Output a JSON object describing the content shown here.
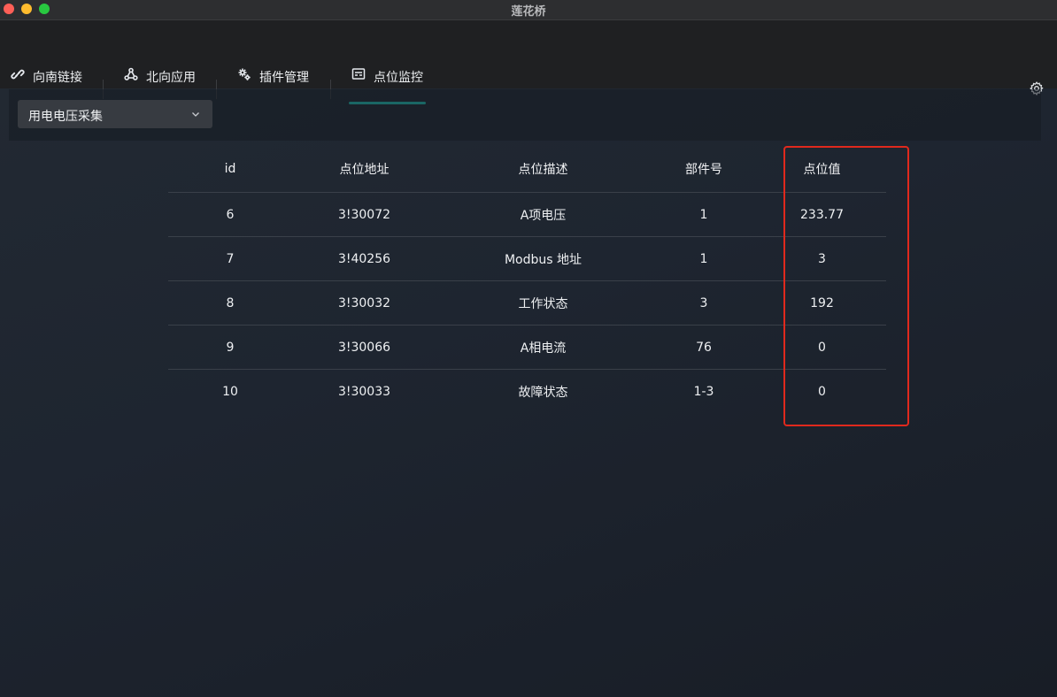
{
  "window": {
    "title": "莲花桥"
  },
  "nav": {
    "tabs": [
      {
        "label": "向南链接",
        "icon": "link-icon"
      },
      {
        "label": "北向应用",
        "icon": "share-nodes-icon"
      },
      {
        "label": "插件管理",
        "icon": "plugin-gear-icon"
      },
      {
        "label": "点位监控",
        "icon": "monitor-icon"
      }
    ],
    "active_tab": "点位监控",
    "settings_icon": "gear-icon"
  },
  "filter": {
    "group_select": {
      "value": "用电电压采集",
      "icon": "chevron-down-icon"
    }
  },
  "table": {
    "headers": {
      "id": "id",
      "address": "点位地址",
      "description": "点位描述",
      "part_no": "部件号",
      "value": "点位值"
    },
    "rows": [
      {
        "id": "6",
        "address": "3!30072",
        "description": "A项电压",
        "part_no": "1",
        "value": "233.77"
      },
      {
        "id": "7",
        "address": "3!40256",
        "description": "Modbus 地址",
        "part_no": "1",
        "value": "3"
      },
      {
        "id": "8",
        "address": "3!30032",
        "description": "工作状态",
        "part_no": "3",
        "value": "192"
      },
      {
        "id": "9",
        "address": "3!30066",
        "description": "A相电流",
        "part_no": "76",
        "value": "0"
      },
      {
        "id": "10",
        "address": "3!30033",
        "description": "故障状态",
        "part_no": "1-3",
        "value": "0"
      }
    ]
  },
  "colors": {
    "accent": "#1fc2b3",
    "highlight_box": "#e0291d",
    "background": "#1e2530"
  }
}
